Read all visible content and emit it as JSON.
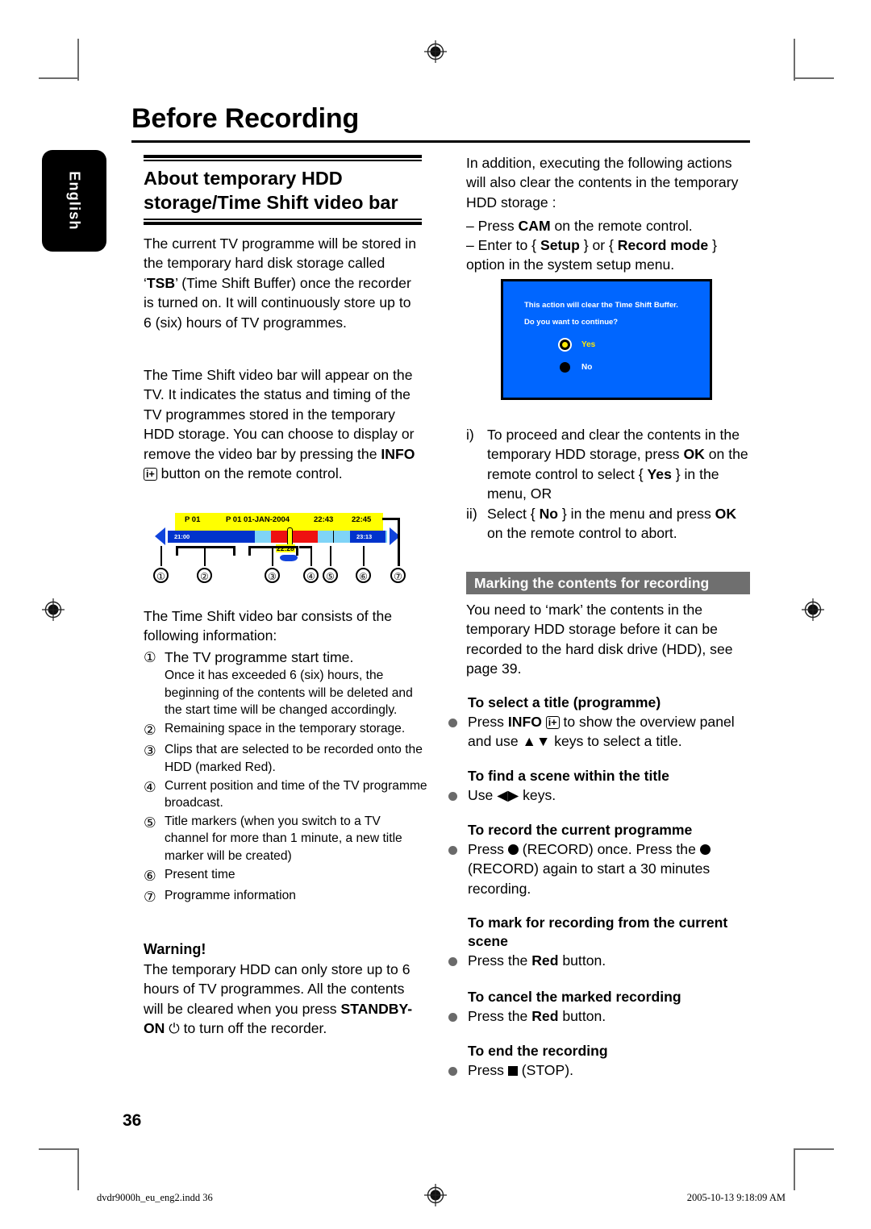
{
  "page": {
    "title": "Before Recording",
    "language_tab": "English",
    "page_number": "36",
    "footer_left": "dvdr9000h_eu_eng2.indd   36",
    "footer_right": "2005-10-13   9:18:09 AM"
  },
  "left_column": {
    "section_heading": "About temporary HDD storage/Time Shift video bar",
    "para1": {
      "part1": "The current TV programme will be stored in the temporary hard disk storage called ‘",
      "bold1": "TSB",
      "part2": "’ (Time Shift Buffer) once the recorder is turned on. It will continuously store up to 6 (six) hours of TV programmes."
    },
    "para2": {
      "part1": "The Time Shift video bar will appear on the TV.  It indicates the status and timing of the TV programmes stored in the temporary HDD storage. You can choose to display or remove the video bar by pressing the ",
      "bold1": "INFO",
      "icon": "i+",
      "part2": " button on the remote control."
    },
    "list_intro": "The Time Shift video bar consists of the following information:",
    "items": [
      {
        "marker": "①",
        "text": "The TV programme start time.",
        "sub": "Once it has exceeded 6 (six) hours, the beginning of the contents will be deleted and the start time will be changed accordingly."
      },
      {
        "marker": "②",
        "text": "Remaining space in the temporary storage.",
        "sub": ""
      },
      {
        "marker": "③",
        "text": "Clips that are selected to be recorded onto the HDD (marked Red).",
        "sub": ""
      },
      {
        "marker": "④",
        "text": "Current position and time of the TV programme broadcast.",
        "sub": ""
      },
      {
        "marker": "⑤",
        "text": "Title markers (when you switch to a TV channel for more than 1 minute, a new title marker will be created)",
        "sub": ""
      },
      {
        "marker": "⑥",
        "text": "Present time",
        "sub": ""
      },
      {
        "marker": "⑦",
        "text": "Programme information",
        "sub": ""
      }
    ],
    "warning": {
      "heading": "Warning!",
      "part1": "The temporary HDD can only store up to 6 hours of TV programmes.  All the contents will be cleared when you press ",
      "bold1": "STANDBY-ON",
      "power_icon": "⏻",
      "part2": " to turn off the recorder."
    }
  },
  "videobar": {
    "top_labels": [
      "P 01",
      "P 01 01-JAN-2004",
      "22:43",
      "22:45"
    ],
    "start_time": "21:00",
    "end_time": "23:13",
    "current_time": "22:28",
    "callouts": [
      "①",
      "②",
      "③",
      "④",
      "⑤",
      "⑥",
      "⑦"
    ],
    "colors": {
      "buffer_used": "#0033cc",
      "buffer_free": "#7fd4f7",
      "marked_clip": "#ee1111",
      "info_band": "#ffff00",
      "arrow": "#1144dd"
    }
  },
  "right_column": {
    "para1": {
      "part1": "In addition, executing the following actions will also clear the contents in the temporary HDD storage :"
    },
    "dash1": {
      "pre": "–  Press ",
      "bold": "CAM",
      "post": " on the remote control."
    },
    "dash2": {
      "pre": "–  Enter to { ",
      "bold1": "Setup",
      "mid": " } or { ",
      "bold2": "Record mode",
      "post": " } option in the system setup menu."
    },
    "dialog": {
      "line1": "This action will clear the Time Shift Buffer.",
      "line2": "Do you want to continue?",
      "option_yes": "Yes",
      "option_no": "No",
      "background": "#0066ff",
      "yes_color": "#ffe800"
    },
    "roman_items": [
      {
        "marker": "i)",
        "pre": "To proceed and clear the contents in the temporary HDD storage, press ",
        "bold1": "OK",
        "mid": " on the remote control to select { ",
        "bold2": "Yes",
        "post": " } in the menu, OR"
      },
      {
        "marker": "ii)",
        "pre": "Select { ",
        "bold1": "No",
        "mid": " } in the menu and press ",
        "bold2": "OK",
        "post": " on the remote control to abort."
      }
    ],
    "banner": "Marking the contents for recording",
    "marking_para": "You need to ‘mark’ the contents in the temporary HDD storage before it can be recorded to the hard disk drive (HDD), see page 39.",
    "sections": [
      {
        "heading": "To select a title (programme)",
        "bullet_pre": "Press ",
        "bullet_bold": "INFO",
        "bullet_icon": "i+",
        "bullet_post": " to show the overview panel and use ▲▼ keys to select a title."
      },
      {
        "heading": "To find a scene within the title",
        "bullet_pre": "Use ",
        "bullet_bold": "",
        "bullet_icon": "",
        "bullet_post": "◀▶ keys."
      },
      {
        "heading": "To record the current programme",
        "bullet_pre": "Press ",
        "bullet_bold": "",
        "bullet_icon": "",
        "bullet_post": " (RECORD) once. Press the  (RECORD) again to start a 30 minutes recording."
      },
      {
        "heading": "To mark for recording from the current scene",
        "bullet_pre": "Press the ",
        "bullet_bold": "Red",
        "bullet_icon": "",
        "bullet_post": " button."
      },
      {
        "heading": "To cancel the marked recording",
        "bullet_pre": "Press the ",
        "bullet_bold": "Red",
        "bullet_icon": "",
        "bullet_post": " button."
      },
      {
        "heading": "To end the recording",
        "bullet_pre": "Press ",
        "bullet_bold": "",
        "bullet_icon": "",
        "bullet_post": " (STOP)."
      }
    ]
  }
}
